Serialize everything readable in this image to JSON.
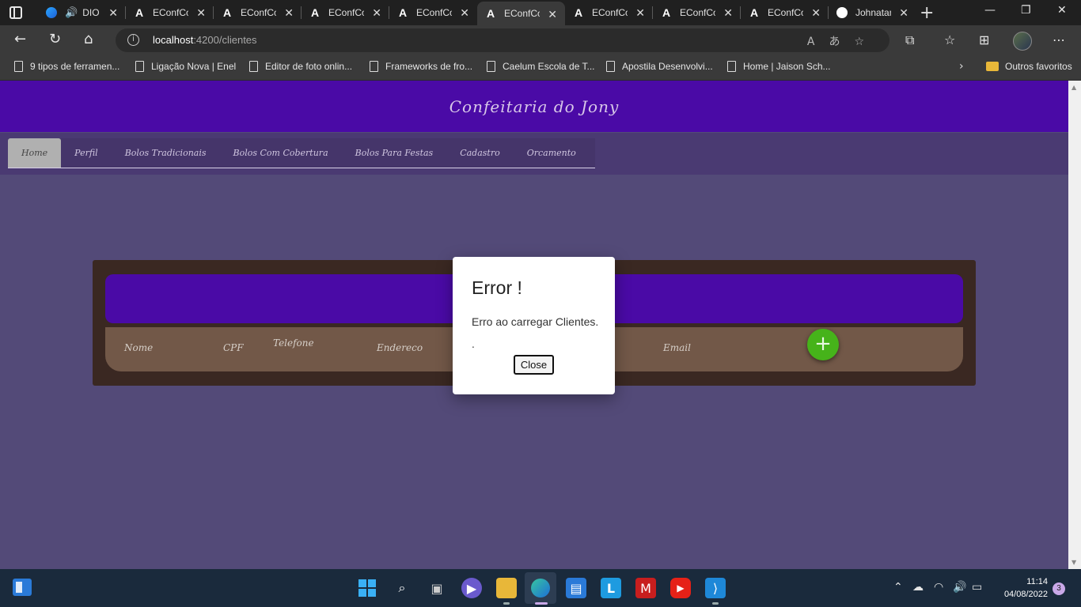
{
  "browser": {
    "tabs": [
      {
        "label": "DIO",
        "icon": "edge-icon",
        "audio": true
      },
      {
        "label": "EConfCo",
        "icon": "angular-icon"
      },
      {
        "label": "EConfCo",
        "icon": "angular-icon"
      },
      {
        "label": "EConfCo",
        "icon": "angular-icon"
      },
      {
        "label": "EConfCo",
        "icon": "angular-icon"
      },
      {
        "label": "EConfCo",
        "icon": "angular-icon",
        "active": true
      },
      {
        "label": "EConfCo",
        "icon": "angular-icon"
      },
      {
        "label": "EConfCo",
        "icon": "angular-icon"
      },
      {
        "label": "EConfCo",
        "icon": "angular-icon"
      },
      {
        "label": "Johnatan",
        "icon": "github-icon"
      }
    ],
    "url_host": "localhost",
    "url_path": ":4200/clientes",
    "favorites": [
      "9 tipos de ferramen...",
      "Ligação Nova | Enel",
      "Editor de foto onlin...",
      "Frameworks de fro...",
      "Caelum Escola de T...",
      "Apostila Desenvolvi...",
      "Home | Jaison Sch..."
    ],
    "other_favorites": "Outros favoritos"
  },
  "site": {
    "title": "Confeitaria do Jony",
    "nav": [
      "Home",
      "Perfil",
      "Bolos Tradicionais",
      "Bolos Com Cobertura",
      "Bolos Para Festas",
      "Cadastro",
      "Orcamento"
    ],
    "active_nav": "Home",
    "columns": [
      "Nome",
      "CPF",
      "Telefone",
      "Endereco",
      "Email"
    ],
    "add_label": "+"
  },
  "modal": {
    "title": "Error !",
    "message": "Erro ao carregar Clientes.",
    "detail": ".",
    "close_label": "Close"
  },
  "taskbar": {
    "time": "11:14",
    "date": "04/08/2022",
    "notifications": "3"
  }
}
